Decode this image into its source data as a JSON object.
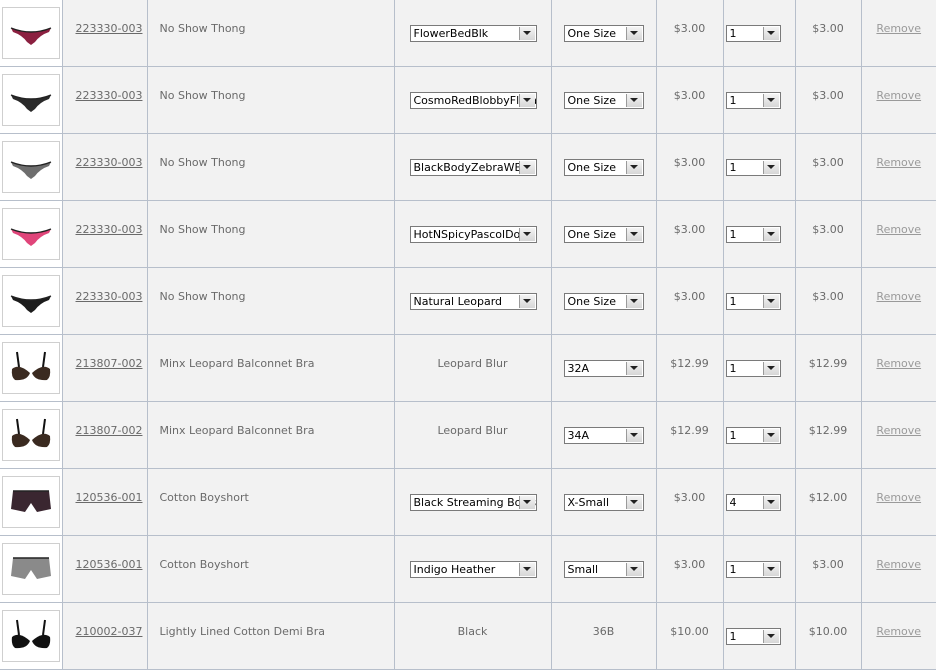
{
  "cart": {
    "remove_label": "Remove",
    "rows": [
      {
        "thumb_icon": "thong-icon",
        "accent": "#8b2040",
        "sku": "223330-003",
        "name": "No Show Thong",
        "color": "FlowerBedBlk",
        "color_is_select": true,
        "size": "One Size",
        "size_is_select": true,
        "price": "$3.00",
        "qty": "1",
        "total": "$3.00"
      },
      {
        "thumb_icon": "thong-icon",
        "accent": "#2a2a2a",
        "sku": "223330-003",
        "name": "No Show Thong",
        "color": "CosmoRedBlobbyFlora",
        "color_is_select": true,
        "size": "One Size",
        "size_is_select": true,
        "price": "$3.00",
        "qty": "1",
        "total": "$3.00"
      },
      {
        "thumb_icon": "thong-icon",
        "accent": "#6e6e6e",
        "sku": "223330-003",
        "name": "No Show Thong",
        "color": "BlackBodyZebraWB",
        "color_is_select": true,
        "size": "One Size",
        "size_is_select": true,
        "price": "$3.00",
        "qty": "1",
        "total": "$3.00"
      },
      {
        "thumb_icon": "thong-icon",
        "accent": "#e0457a",
        "sku": "223330-003",
        "name": "No Show Thong",
        "color": "HotNSpicyPascolDot",
        "color_is_select": true,
        "size": "One Size",
        "size_is_select": true,
        "price": "$3.00",
        "qty": "1",
        "total": "$3.00"
      },
      {
        "thumb_icon": "thong-icon",
        "accent": "#1c1c1c",
        "sku": "223330-003",
        "name": "No Show Thong",
        "color": "Natural Leopard",
        "color_is_select": true,
        "size": "One Size",
        "size_is_select": true,
        "price": "$3.00",
        "qty": "1",
        "total": "$3.00"
      },
      {
        "thumb_icon": "bra-icon",
        "accent": "#3a2a20",
        "sku": "213807-002",
        "name": "Minx Leopard Balconnet Bra",
        "color": "Leopard Blur",
        "color_is_select": false,
        "size": "32A",
        "size_is_select": true,
        "price": "$12.99",
        "qty": "1",
        "total": "$12.99"
      },
      {
        "thumb_icon": "bra-icon",
        "accent": "#3a2a20",
        "sku": "213807-002",
        "name": "Minx Leopard Balconnet Bra",
        "color": "Leopard Blur",
        "color_is_select": false,
        "size": "34A",
        "size_is_select": true,
        "price": "$12.99",
        "qty": "1",
        "total": "$12.99"
      },
      {
        "thumb_icon": "boyshort-icon",
        "accent": "#3a2630",
        "sku": "120536-001",
        "name": "Cotton Boyshort",
        "color": "Black Streaming Bows",
        "color_is_select": true,
        "size": "X-Small",
        "size_is_select": true,
        "price": "$3.00",
        "qty": "4",
        "total": "$12.00"
      },
      {
        "thumb_icon": "boyshort-icon",
        "accent": "#8a8a8a",
        "sku": "120536-001",
        "name": "Cotton Boyshort",
        "color": "Indigo Heather",
        "color_is_select": true,
        "size": "Small",
        "size_is_select": true,
        "price": "$3.00",
        "qty": "1",
        "total": "$3.00"
      },
      {
        "thumb_icon": "bra-icon",
        "accent": "#111111",
        "sku": "210002-037",
        "name": "Lightly Lined Cotton Demi Bra",
        "color": "Black",
        "color_is_select": false,
        "size": "36B",
        "size_is_select": false,
        "price": "$10.00",
        "qty": "1",
        "total": "$10.00"
      }
    ]
  }
}
